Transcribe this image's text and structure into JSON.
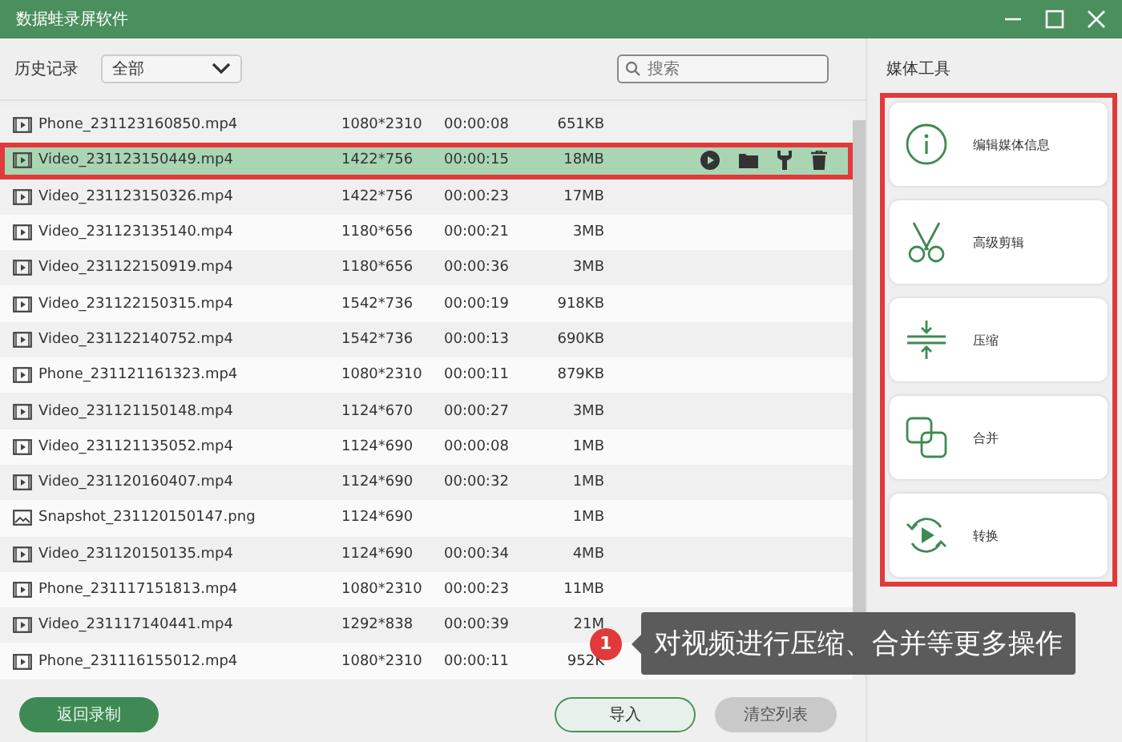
{
  "window": {
    "title": "数据蛙录屏软件"
  },
  "toolbar": {
    "history_label": "历史记录",
    "filter": "全部",
    "search_placeholder": "搜索"
  },
  "files": [
    {
      "kind": "video",
      "name": "Phone_231123160850.mp4",
      "resolution": "1080*2310",
      "duration": "00:00:08",
      "size": "651KB",
      "selected": false
    },
    {
      "kind": "video",
      "name": "Video_231123150449.mp4",
      "resolution": "1422*756",
      "duration": "00:00:15",
      "size": "18MB",
      "selected": true
    },
    {
      "kind": "video",
      "name": "Video_231123150326.mp4",
      "resolution": "1422*756",
      "duration": "00:00:23",
      "size": "17MB",
      "selected": false
    },
    {
      "kind": "video",
      "name": "Video_231123135140.mp4",
      "resolution": "1180*656",
      "duration": "00:00:21",
      "size": "3MB",
      "selected": false
    },
    {
      "kind": "video",
      "name": "Video_231122150919.mp4",
      "resolution": "1180*656",
      "duration": "00:00:36",
      "size": "3MB",
      "selected": false
    },
    {
      "kind": "video",
      "name": "Video_231122150315.mp4",
      "resolution": "1542*736",
      "duration": "00:00:19",
      "size": "918KB",
      "selected": false
    },
    {
      "kind": "video",
      "name": "Video_231122140752.mp4",
      "resolution": "1542*736",
      "duration": "00:00:13",
      "size": "690KB",
      "selected": false
    },
    {
      "kind": "video",
      "name": "Phone_231121161323.mp4",
      "resolution": "1080*2310",
      "duration": "00:00:11",
      "size": "879KB",
      "selected": false
    },
    {
      "kind": "video",
      "name": "Video_231121150148.mp4",
      "resolution": "1124*670",
      "duration": "00:00:27",
      "size": "3MB",
      "selected": false
    },
    {
      "kind": "video",
      "name": "Video_231121135052.mp4",
      "resolution": "1124*690",
      "duration": "00:00:08",
      "size": "1MB",
      "selected": false
    },
    {
      "kind": "video",
      "name": "Video_231120160407.mp4",
      "resolution": "1124*690",
      "duration": "00:00:32",
      "size": "1MB",
      "selected": false
    },
    {
      "kind": "image",
      "name": "Snapshot_231120150147.png",
      "resolution": "1124*690",
      "size": "1MB",
      "selected": false
    },
    {
      "kind": "video",
      "name": "Video_231120150135.mp4",
      "resolution": "1124*690",
      "duration": "00:00:34",
      "size": "4MB",
      "selected": false
    },
    {
      "kind": "video",
      "name": "Phone_231117151813.mp4",
      "resolution": "1080*2310",
      "duration": "00:00:23",
      "size": "11MB",
      "selected": false
    },
    {
      "kind": "video",
      "name": "Video_231117140441.mp4",
      "resolution": "1292*838",
      "duration": "00:00:39",
      "size": "21M",
      "selected": false
    },
    {
      "kind": "video",
      "name": "Phone_231116155012.mp4",
      "resolution": "1080*2310",
      "duration": "00:00:11",
      "size": "952K",
      "selected": false
    }
  ],
  "buttons": {
    "back": "返回录制",
    "import": "导入",
    "clear": "清空列表"
  },
  "media_tools": {
    "title": "媒体工具",
    "items": [
      {
        "kind": "info",
        "label": "编辑媒体信息"
      },
      {
        "kind": "cut",
        "label": "高级剪辑"
      },
      {
        "kind": "compress",
        "label": "压缩"
      },
      {
        "kind": "merge",
        "label": "合并"
      },
      {
        "kind": "convert",
        "label": "转换"
      }
    ]
  },
  "callout": {
    "number": "1",
    "text": "对视频进行压缩、合并等更多操作"
  }
}
